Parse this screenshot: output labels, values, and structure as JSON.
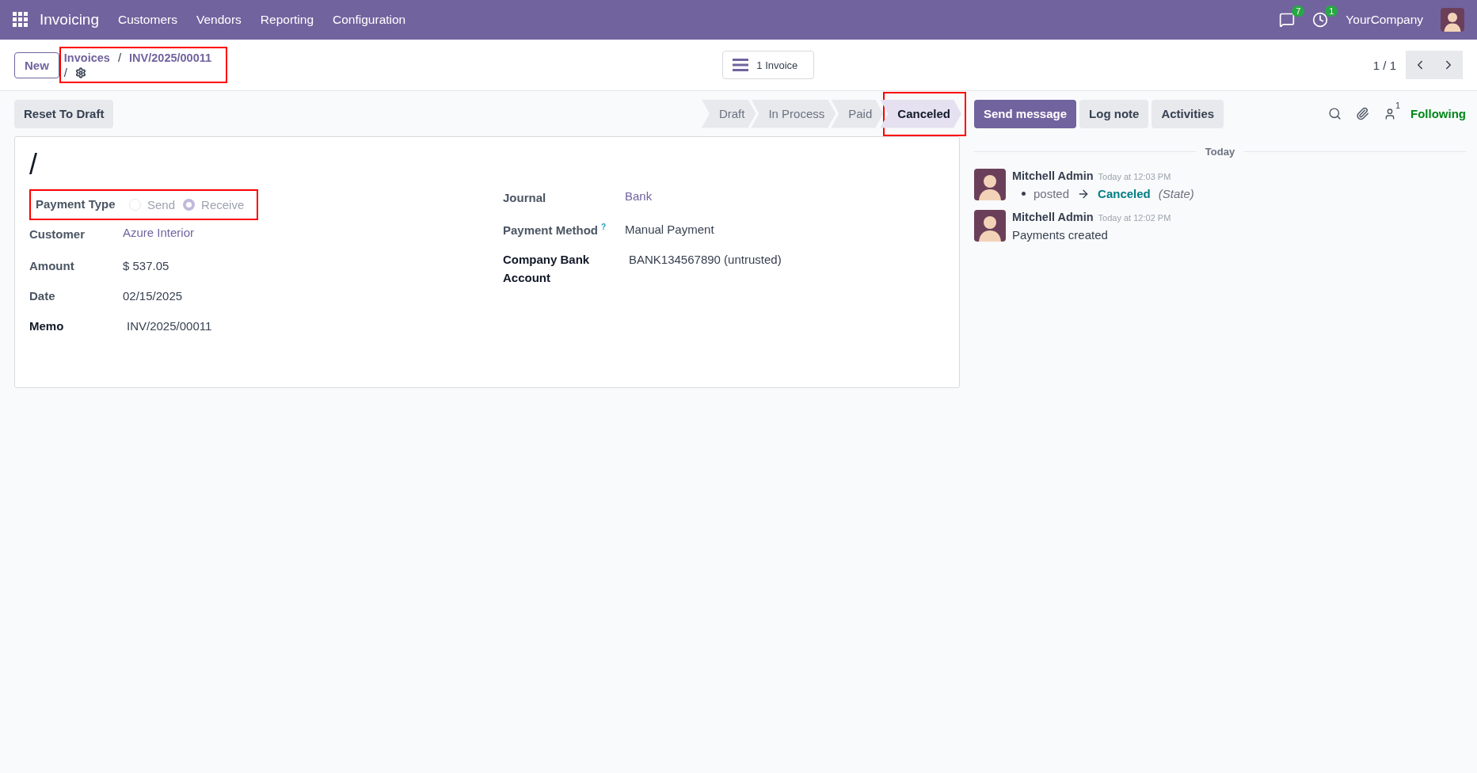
{
  "navbar": {
    "app_name": "Invoicing",
    "menu": [
      "Customers",
      "Vendors",
      "Reporting",
      "Configuration"
    ],
    "messages_badge": "7",
    "activities_badge": "1",
    "company": "YourCompany"
  },
  "control_panel": {
    "new_button": "New",
    "breadcrumbs": [
      "Invoices",
      "INV/2025/00011"
    ],
    "breadcrumb_separator": "/",
    "record_name": "/",
    "highlighted": true,
    "smart_button": "1 Invoice",
    "pager": "1 / 1"
  },
  "statusbar": {
    "buttons": [
      "Reset To Draft"
    ],
    "stages": [
      {
        "label": "Draft",
        "selected": false,
        "highlighted": false
      },
      {
        "label": "In Process",
        "selected": false,
        "highlighted": false
      },
      {
        "label": "Paid",
        "selected": false,
        "highlighted": false
      },
      {
        "label": "Canceled",
        "selected": true,
        "highlighted": true
      }
    ]
  },
  "form": {
    "title": "/",
    "left_fields": [
      {
        "kind": "radio",
        "label": "Payment Type",
        "highlighted": true,
        "options": [
          {
            "label": "Send",
            "selected": false
          },
          {
            "label": "Receive",
            "selected": true
          }
        ]
      },
      {
        "kind": "link",
        "label": "Customer",
        "value": "Azure Interior"
      },
      {
        "kind": "text",
        "label": "Amount",
        "value": "$ 537.05"
      },
      {
        "kind": "text",
        "label": "Date",
        "value": "02/15/2025"
      },
      {
        "kind": "text",
        "label": "Memo",
        "value": "INV/2025/00011",
        "required": true
      }
    ],
    "right_fields": [
      {
        "kind": "link",
        "label": "Journal",
        "value": "Bank"
      },
      {
        "kind": "text",
        "label": "Payment Method",
        "help": "?",
        "value": "Manual Payment"
      },
      {
        "kind": "text",
        "label": "Company Bank Account",
        "value": "BANK134567890 (untrusted)",
        "required": true
      }
    ]
  },
  "chatter": {
    "buttons": [
      {
        "label": "Send message",
        "primary": true
      },
      {
        "label": "Log note",
        "primary": false
      },
      {
        "label": "Activities",
        "primary": false
      }
    ],
    "followers_count": "1",
    "following": "Following",
    "date_separator": "Today",
    "messages": [
      {
        "author": "Mitchell Admin",
        "time": "Today at 12:03 PM",
        "kind": "tracking",
        "old_value": "posted",
        "new_value": "Canceled",
        "field": "(State)"
      },
      {
        "author": "Mitchell Admin",
        "time": "Today at 12:02 PM",
        "kind": "body",
        "body": "Payments created"
      }
    ]
  }
}
